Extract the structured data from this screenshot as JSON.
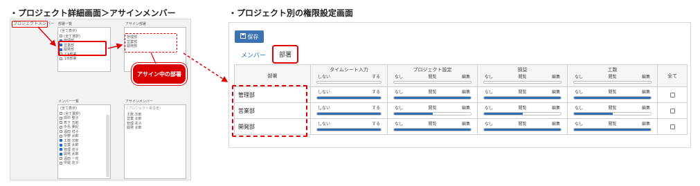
{
  "headings": {
    "left": "・プロジェクト詳細画面＞アサインメンバー",
    "right": "・プロジェクト別の権限設定画面"
  },
  "left_panel": {
    "project_member_label": "プロジェクトメンバー",
    "dept_list": {
      "title": "部署一覧",
      "filter": "(全て表示)",
      "items": [
        {
          "label": "(全て選択)",
          "checked": false
        },
        {
          "label": "管理部",
          "checked": true
        },
        {
          "label": "営業部",
          "checked": true
        },
        {
          "label": "開発部",
          "checked": true
        },
        {
          "label": "工A部署",
          "checked": false
        },
        {
          "label": "工B部署",
          "checked": false
        }
      ]
    },
    "assign_dept": {
      "title": "アサイン部署",
      "items": [
        "管理部",
        "営業部",
        "開発部"
      ]
    },
    "callout": "アサイン中の部署",
    "member_list": {
      "title": "メンバー一覧",
      "filter": "(全て表示)",
      "items": [
        {
          "label": "(全て選択)",
          "checked": false
        },
        {
          "label": "田中 聖子",
          "checked": false
        },
        {
          "label": "斎下 五郎",
          "checked": false
        },
        {
          "label": "中島 美紀",
          "checked": false
        },
        {
          "label": "酒田 祥子",
          "checked": false
        },
        {
          "label": "中野 太郎",
          "checked": false
        },
        {
          "label": "工数 次郎",
          "checked": true
        },
        {
          "label": "営業 太郎",
          "checked": true
        },
        {
          "label": "管理 花子",
          "checked": true
        },
        {
          "label": "開発 太郎",
          "checked": true
        },
        {
          "label": "酒田 一花",
          "checked": false
        },
        {
          "label": "中尾 花子",
          "checked": false
        }
      ]
    },
    "assign_member": {
      "title": "アサインメンバー",
      "filter": "(プロジェクト責任者)",
      "items": [
        "工数 次郎",
        "営業 太郎",
        "管理 花子",
        "開発 太郎"
      ]
    }
  },
  "right_panel": {
    "save_label": "保存",
    "tabs": [
      {
        "label": "メンバー",
        "active": false
      },
      {
        "label": "部署",
        "active": true
      }
    ],
    "table": {
      "dept_header": "部署",
      "all_header": "全て",
      "columns": [
        {
          "title": "タイムシート入力",
          "levels": [
            "しない",
            "する"
          ]
        },
        {
          "title": "プロジェクト設定",
          "levels": [
            "なし",
            "閲覧",
            "編集"
          ]
        },
        {
          "title": "損益",
          "levels": [
            "なし",
            "閲覧",
            "編集"
          ]
        },
        {
          "title": "工数",
          "levels": [
            "なし",
            "閲覧",
            "編集"
          ]
        }
      ],
      "rows": [
        {
          "dept": "管理部",
          "values": [
            1.0,
            1.0,
            1.0,
            1.0
          ],
          "all": false
        },
        {
          "dept": "営業部",
          "values": [
            1.0,
            0.5,
            0.5,
            0.5
          ],
          "all": false
        },
        {
          "dept": "開発部",
          "values": [
            1.0,
            1.0,
            1.0,
            1.0
          ],
          "all": false
        }
      ]
    }
  },
  "colors": {
    "accent": "#e00000",
    "primary": "#3d72b4",
    "bar_fill": "#2f6fb0"
  }
}
